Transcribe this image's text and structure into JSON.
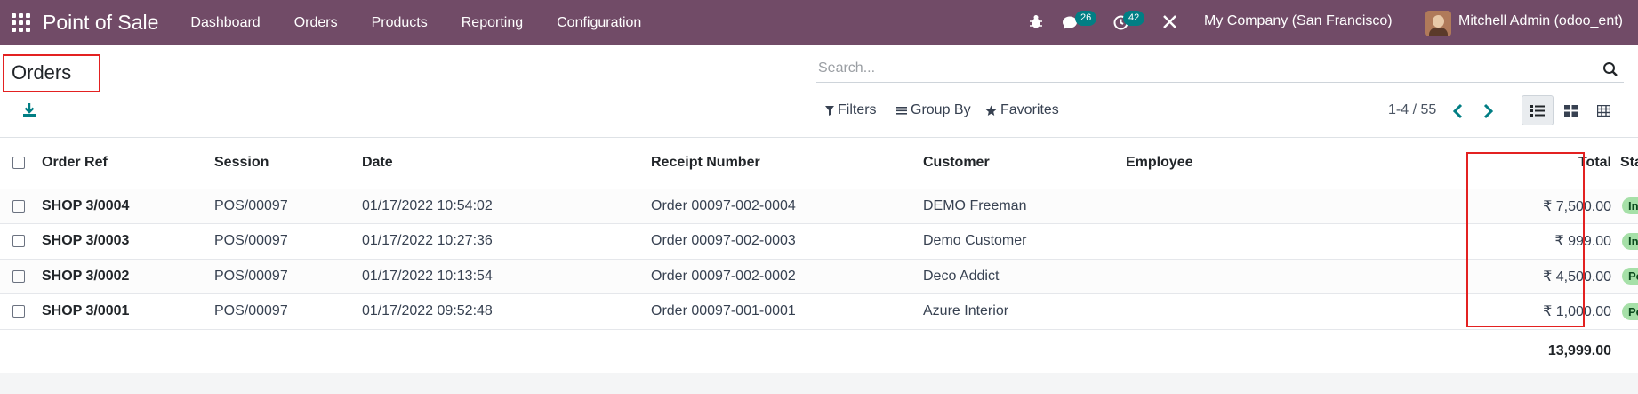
{
  "navbar": {
    "brand": "Point of Sale",
    "menu": [
      "Dashboard",
      "Orders",
      "Products",
      "Reporting",
      "Configuration"
    ],
    "messages_count": "26",
    "activities_count": "42",
    "company": "My Company (San Francisco)",
    "user": "Mitchell Admin (odoo_ent)"
  },
  "control_panel": {
    "title": "Orders",
    "search_placeholder": "Search...",
    "filters_label": "Filters",
    "group_by_label": "Group By",
    "favorites_label": "Favorites",
    "pager": "1-4 / 55"
  },
  "table": {
    "headers": {
      "order_ref": "Order Ref",
      "session": "Session",
      "date": "Date",
      "receipt": "Receipt Number",
      "customer": "Customer",
      "employee": "Employee",
      "total": "Total",
      "status": "Status"
    },
    "rows": [
      {
        "order_ref": "SHOP 3/0004",
        "session": "POS/00097",
        "date": "01/17/2022 10:54:02",
        "receipt": "Order 00097-002-0004",
        "customer": "DEMO Freeman",
        "employee": "",
        "total": "₹ 7,500.00",
        "status": "Invoiced"
      },
      {
        "order_ref": "SHOP 3/0003",
        "session": "POS/00097",
        "date": "01/17/2022 10:27:36",
        "receipt": "Order 00097-002-0003",
        "customer": "Demo Customer",
        "employee": "",
        "total": "₹ 999.00",
        "status": "Invoiced"
      },
      {
        "order_ref": "SHOP 3/0002",
        "session": "POS/00097",
        "date": "01/17/2022 10:13:54",
        "receipt": "Order 00097-002-0002",
        "customer": "Deco Addict",
        "employee": "",
        "total": "₹ 4,500.00",
        "status": "Posted"
      },
      {
        "order_ref": "SHOP 3/0001",
        "session": "POS/00097",
        "date": "01/17/2022 09:52:48",
        "receipt": "Order 00097-001-0001",
        "customer": "Azure Interior",
        "employee": "",
        "total": "₹ 1,000.00",
        "status": "Posted"
      }
    ],
    "grand_total": "13,999.00"
  },
  "colors": {
    "navbar": "#714b67",
    "accent": "#017e84",
    "highlight_box": "#e32121",
    "status_badge": "#a6e0a8"
  }
}
